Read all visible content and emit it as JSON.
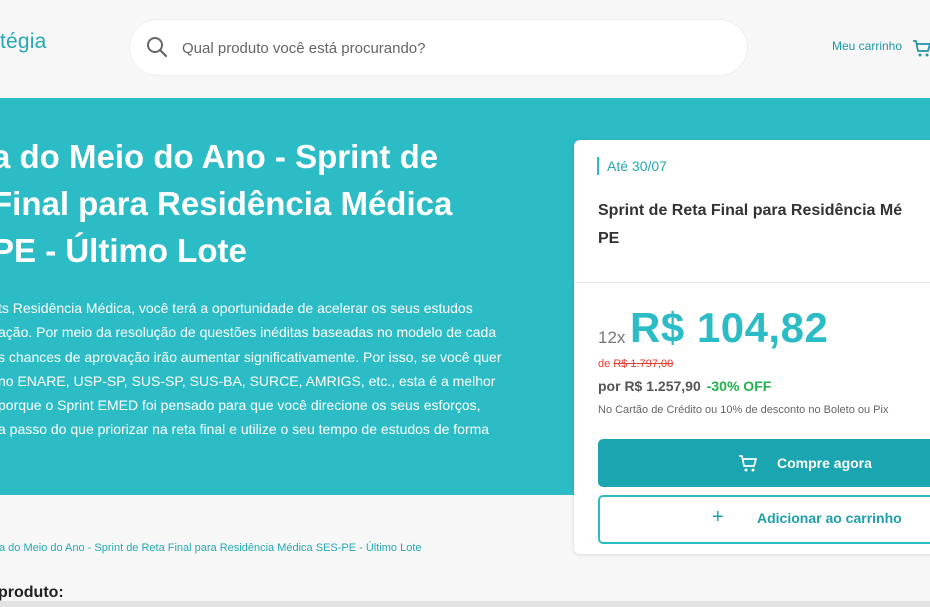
{
  "header": {
    "logo_text": "tégia",
    "search_placeholder": "Qual produto você está procurando?",
    "cart_label": "Meu carrinho"
  },
  "hero": {
    "title_lines": [
      "a do Meio do Ano - Sprint de",
      "Final para Residência Médica",
      "PE - Último Lote"
    ],
    "description_lines": [
      "ts Residência Médica, você terá a oportunidade de acelerar os seus estudos",
      "ação. Por meio da resolução de questões inéditas baseadas no modelo de cada",
      "s chances de aprovação irão aumentar significativamente. Por isso, se você quer",
      "no ENARE, USP-SP, SUS-SP, SUS-BA, SURCE, AMRIGS, etc., esta é a melhor",
      "porque o Sprint EMED foi pensado para que você direcione os seus esforços,",
      "a passo do que priorizar na reta final e utilize o seu tempo de estudos de forma"
    ]
  },
  "card": {
    "deadline": "Até 30/07",
    "product_lines": [
      "Sprint de Reta Final para Residência Mé",
      "PE"
    ],
    "installments": "12x",
    "price": "R$ 104,82",
    "old_price_prefix": "de",
    "old_price": "R$ 1.797,00",
    "full_price": "por R$ 1.257,90",
    "discount": "-30% OFF",
    "payment_terms": "No Cartão de Crédito ou 10% de desconto no Boleto ou Pix",
    "buy_label": "Compre agora",
    "add_label": "Adicionar ao carrinho",
    "add_icon": "+"
  },
  "breadcrumb": "a do Meio do Ano - Sprint de Reta Final para Residência Médica SES-PE - Último Lote",
  "section_title": "produto:",
  "colors": {
    "brand": "#2cbcc6",
    "button": "#1aa5b0",
    "discount": "#21b24b",
    "old_price": "#e03c31"
  },
  "icons": [
    "search-icon",
    "cart-icon"
  ]
}
